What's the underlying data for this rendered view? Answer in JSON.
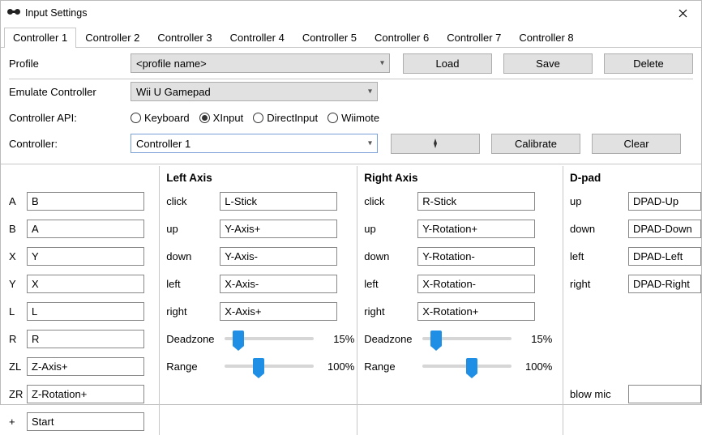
{
  "window": {
    "title": "Input Settings"
  },
  "tabs": [
    "Controller 1",
    "Controller 2",
    "Controller 3",
    "Controller 4",
    "Controller 5",
    "Controller 6",
    "Controller 7",
    "Controller 8"
  ],
  "active_tab": 0,
  "profile": {
    "label": "Profile",
    "placeholder": "<profile name>",
    "load": "Load",
    "save": "Save",
    "delete": "Delete"
  },
  "emulate": {
    "label": "Emulate Controller",
    "value": "Wii U Gamepad"
  },
  "api": {
    "label": "Controller API:",
    "options": [
      "Keyboard",
      "XInput",
      "DirectInput",
      "Wiimote"
    ],
    "selected": "XInput"
  },
  "controller": {
    "label": "Controller:",
    "value": "Controller 1",
    "calibrate": "Calibrate",
    "clear": "Clear"
  },
  "buttons": {
    "rows": [
      {
        "label": "A",
        "value": "B"
      },
      {
        "label": "B",
        "value": "A"
      },
      {
        "label": "X",
        "value": "Y"
      },
      {
        "label": "Y",
        "value": "X"
      },
      {
        "label": "L",
        "value": "L"
      },
      {
        "label": "R",
        "value": "R"
      },
      {
        "label": "ZL",
        "value": "Z-Axis+"
      },
      {
        "label": "ZR",
        "value": "Z-Rotation+"
      },
      {
        "label": "+",
        "value": "Start"
      }
    ]
  },
  "left_axis": {
    "header": "Left Axis",
    "rows": [
      {
        "label": "click",
        "value": "L-Stick"
      },
      {
        "label": "up",
        "value": "Y-Axis+"
      },
      {
        "label": "down",
        "value": "Y-Axis-"
      },
      {
        "label": "left",
        "value": "X-Axis-"
      },
      {
        "label": "right",
        "value": "X-Axis+"
      }
    ],
    "deadzone_label": "Deadzone",
    "deadzone_value": "15%",
    "deadzone_pct": 15,
    "range_label": "Range",
    "range_value": "100%",
    "range_pct": 38
  },
  "right_axis": {
    "header": "Right Axis",
    "rows": [
      {
        "label": "click",
        "value": "R-Stick"
      },
      {
        "label": "up",
        "value": "Y-Rotation+"
      },
      {
        "label": "down",
        "value": "Y-Rotation-"
      },
      {
        "label": "left",
        "value": "X-Rotation-"
      },
      {
        "label": "right",
        "value": "X-Rotation+"
      }
    ],
    "deadzone_label": "Deadzone",
    "deadzone_value": "15%",
    "deadzone_pct": 15,
    "range_label": "Range",
    "range_value": "100%",
    "range_pct": 55
  },
  "dpad": {
    "header": "D-pad",
    "rows": [
      {
        "label": "up",
        "value": "DPAD-Up"
      },
      {
        "label": "down",
        "value": "DPAD-Down"
      },
      {
        "label": "left",
        "value": "DPAD-Left"
      },
      {
        "label": "right",
        "value": "DPAD-Right"
      }
    ],
    "blow_mic": "blow mic"
  }
}
